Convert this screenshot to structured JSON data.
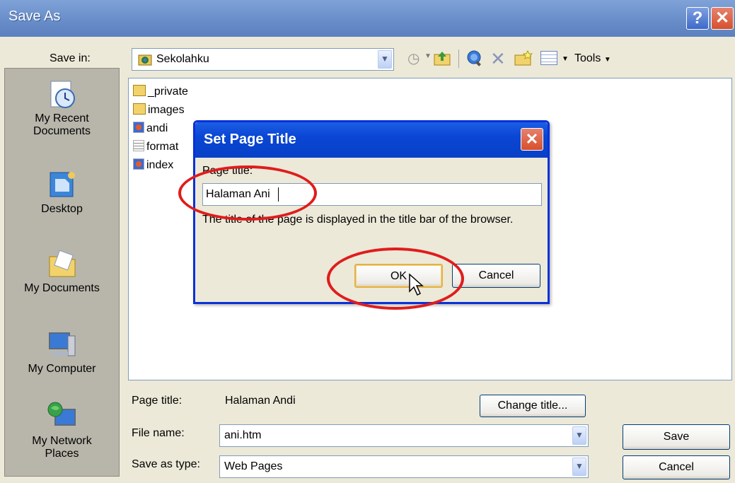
{
  "window": {
    "title": "Save As",
    "help_glyph": "?",
    "close_glyph": "✕"
  },
  "toolbar": {
    "save_in_label": "Save in:",
    "save_in_value": "Sekolahku",
    "tools_label": "Tools"
  },
  "places": [
    {
      "label_line1": "My Recent",
      "label_line2": "Documents",
      "icon": "recent-documents-icon"
    },
    {
      "label_line1": "Desktop",
      "label_line2": "",
      "icon": "desktop-icon"
    },
    {
      "label_line1": "My Documents",
      "label_line2": "",
      "icon": "my-documents-icon"
    },
    {
      "label_line1": "My Computer",
      "label_line2": "",
      "icon": "my-computer-icon"
    },
    {
      "label_line1": "My Network",
      "label_line2": "Places",
      "icon": "network-places-icon"
    }
  ],
  "files": [
    {
      "name": "_private",
      "icon": "folder-icon"
    },
    {
      "name": "images",
      "icon": "folder-icon"
    },
    {
      "name": "andi",
      "icon": "web-page-icon"
    },
    {
      "name": "format",
      "icon": "text-file-icon"
    },
    {
      "name": "index",
      "icon": "web-page-icon"
    }
  ],
  "bottom": {
    "page_title_label": "Page title:",
    "page_title_value": "Halaman Andi",
    "change_title_label": "Change title...",
    "file_name_label": "File name:",
    "file_name_value": "ani.htm",
    "save_as_type_label": "Save as type:",
    "save_as_type_value": "Web Pages",
    "save_label": "Save",
    "cancel_label": "Cancel"
  },
  "dialog": {
    "title": "Set Page Title",
    "field_label": "Page title:",
    "field_value": "Halaman Ani",
    "help_text": "The title of the page is displayed in the title bar of the browser.",
    "ok_label": "OK",
    "cancel_label": "Cancel"
  },
  "colors": {
    "highlight_ring": "#e01c1c",
    "dialog_title": "#0a46d4",
    "window_title": "#6b8fca"
  }
}
